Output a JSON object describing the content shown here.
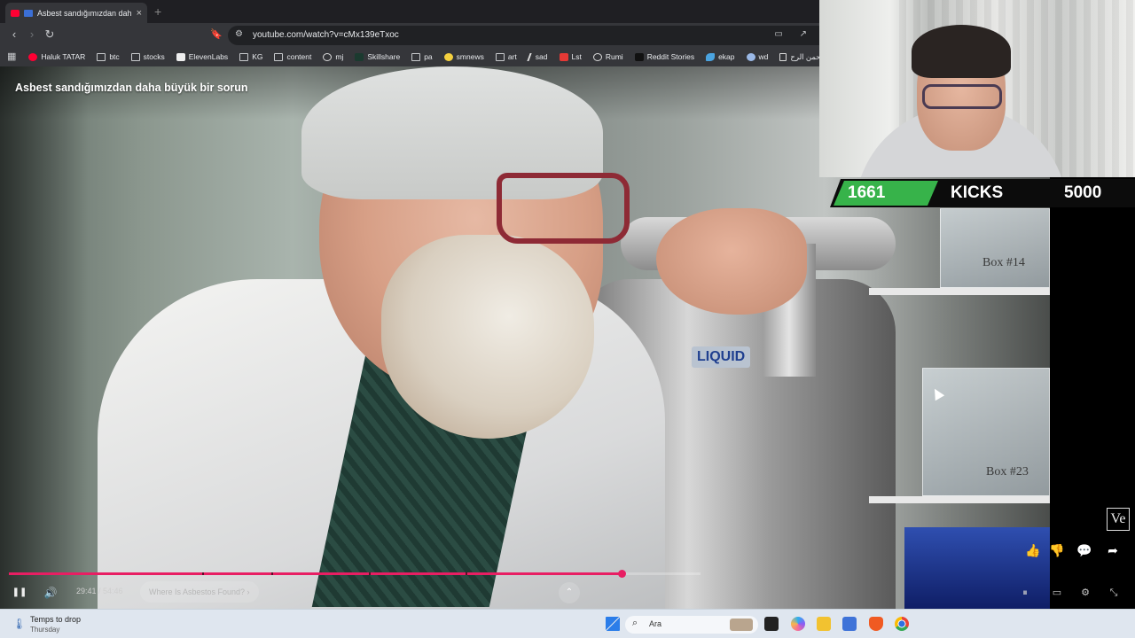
{
  "browser": {
    "tab_title": "Asbest sandığımızdan daha b",
    "tab_close": "×",
    "new_tab": "+",
    "url": "youtube.com/watch?v=cMx139eTxoc",
    "nav": {
      "back": "‹",
      "forward": "›",
      "reload": "↻"
    },
    "bookmarks": [
      {
        "label": "Haluk TATAR",
        "icon": "youtube-icon"
      },
      {
        "label": "btc",
        "icon": "folder-icon"
      },
      {
        "label": "stocks",
        "icon": "folder-icon"
      },
      {
        "label": "ElevenLabs",
        "icon": "elevenlabs-icon"
      },
      {
        "label": "KG",
        "icon": "folder-icon"
      },
      {
        "label": "content",
        "icon": "folder-icon"
      },
      {
        "label": "mj",
        "icon": "github-icon"
      },
      {
        "label": "Skillshare",
        "icon": "skillshare-icon"
      },
      {
        "label": "pa",
        "icon": "folder-icon"
      },
      {
        "label": "smnews",
        "icon": "smile-icon"
      },
      {
        "label": "art",
        "icon": "folder-icon"
      },
      {
        "label": "sad",
        "icon": "slash-icon"
      },
      {
        "label": "Lst",
        "icon": "s-logo-icon"
      },
      {
        "label": "Rumi",
        "icon": "globe-icon"
      },
      {
        "label": "Reddit Stories",
        "icon": "d-logo-icon"
      },
      {
        "label": "ekap",
        "icon": "bird-icon"
      },
      {
        "label": "wd",
        "icon": "wd-icon"
      },
      {
        "label": "الله الرحمن الرح...",
        "icon": "page-icon"
      }
    ]
  },
  "video": {
    "title": "Asbest sandığımızdan daha büyük bir sorun",
    "liquid_label": "LIQUID",
    "box_14": "Box #14",
    "box_23": "Box #23",
    "watermark": "Ve",
    "time_display": "29:41 / 54:46",
    "chapter": "Where Is Asbestos Found?  ›",
    "progress": 0.886,
    "chapter_marks": [
      0.28,
      0.38,
      0.52,
      0.66
    ],
    "icons": {
      "pause": "❚❚",
      "volume": "🔊",
      "chevron_up": "⌃",
      "like": "👍",
      "dislike": "👎",
      "comments": "💬",
      "share": "➦",
      "miniplayer": "⏸",
      "subtitles": "▭",
      "settings": "⚙",
      "fullscreen_exit": "⤡"
    }
  },
  "stream_overlay": {
    "kicks_current": "1661",
    "kicks_label": "KICKS",
    "kicks_goal": "5000",
    "accent_green": "#37b34a"
  },
  "taskbar": {
    "weather_title": "Temps to drop",
    "weather_sub": "Thursday",
    "search_label": "Ara",
    "apps": [
      "windows-start-icon",
      "task-view-icon",
      "copilot-icon",
      "file-explorer-icon",
      "snipping-tool-icon",
      "brave-icon",
      "chrome-icon"
    ]
  }
}
